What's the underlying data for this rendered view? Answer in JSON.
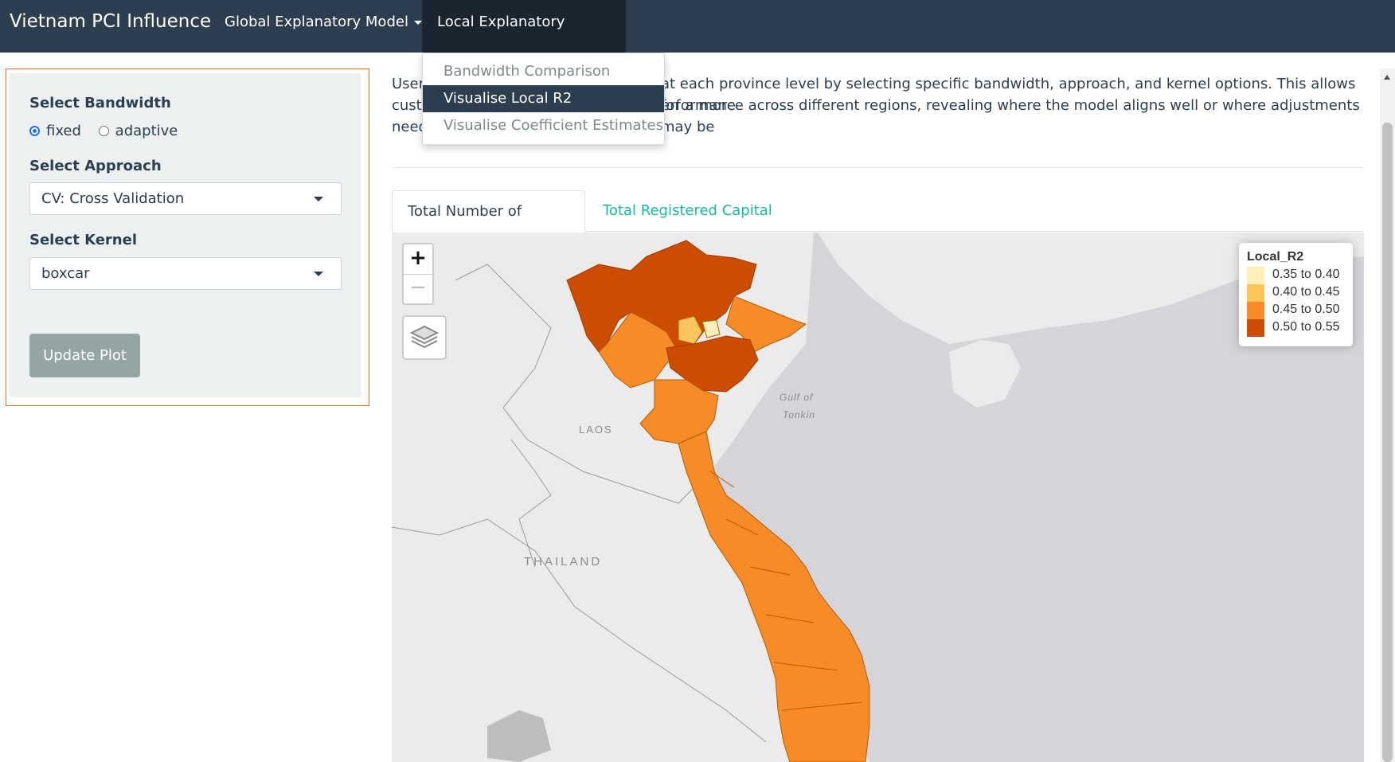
{
  "navbar": {
    "brand": "Vietnam PCI Influence",
    "items": [
      {
        "label": "Global Explanatory Model"
      },
      {
        "label": "Local Explanatory Model"
      }
    ],
    "dropdown": [
      {
        "label": "Bandwidth Comparison",
        "active": false
      },
      {
        "label": "Visualise Local R2",
        "active": true
      },
      {
        "label": "Visualise Coefficient Estimates",
        "active": false
      }
    ]
  },
  "sidebar": {
    "bandwidth_label": "Select Bandwidth",
    "bandwidth_options": [
      {
        "label": "fixed",
        "checked": true
      },
      {
        "label": "adaptive",
        "checked": false
      }
    ],
    "approach_label": "Select Approach",
    "approach_value": "CV: Cross Validation",
    "kernel_label": "Select Kernel",
    "kernel_value": "boxcar",
    "update_button": "Update Plot"
  },
  "main": {
    "description_lines": [
      "User",
      "at each province level by selecting specific bandwidth, approach, and kernel options. This allows for a more",
      "custo",
      "erformance across different regions, revealing where the model aligns well or where adjustments may be",
      "need"
    ],
    "tabs": [
      {
        "label": "Total Number of Projects",
        "active": true
      },
      {
        "label": "Total Registered Capital",
        "active": false
      }
    ]
  },
  "map": {
    "zoom_in": "+",
    "zoom_out": "−",
    "layers_icon": "layers-icon",
    "labels": [
      "LAOS",
      "THAILAND",
      "Gulf of",
      "Tonkin"
    ],
    "legend": {
      "title": "Local_R2",
      "items": [
        {
          "label": "0.35 to 0.40",
          "color": "#feefb8"
        },
        {
          "label": "0.40 to 0.45",
          "color": "#fdc55d"
        },
        {
          "label": "0.45 to 0.50",
          "color": "#f78b28"
        },
        {
          "label": "0.50 to 0.55",
          "color": "#cc4c02"
        }
      ]
    }
  },
  "colors": {
    "navbar": "#2c3e50",
    "accent": "#18bc9c",
    "sidebar_border": "#f26b21"
  }
}
